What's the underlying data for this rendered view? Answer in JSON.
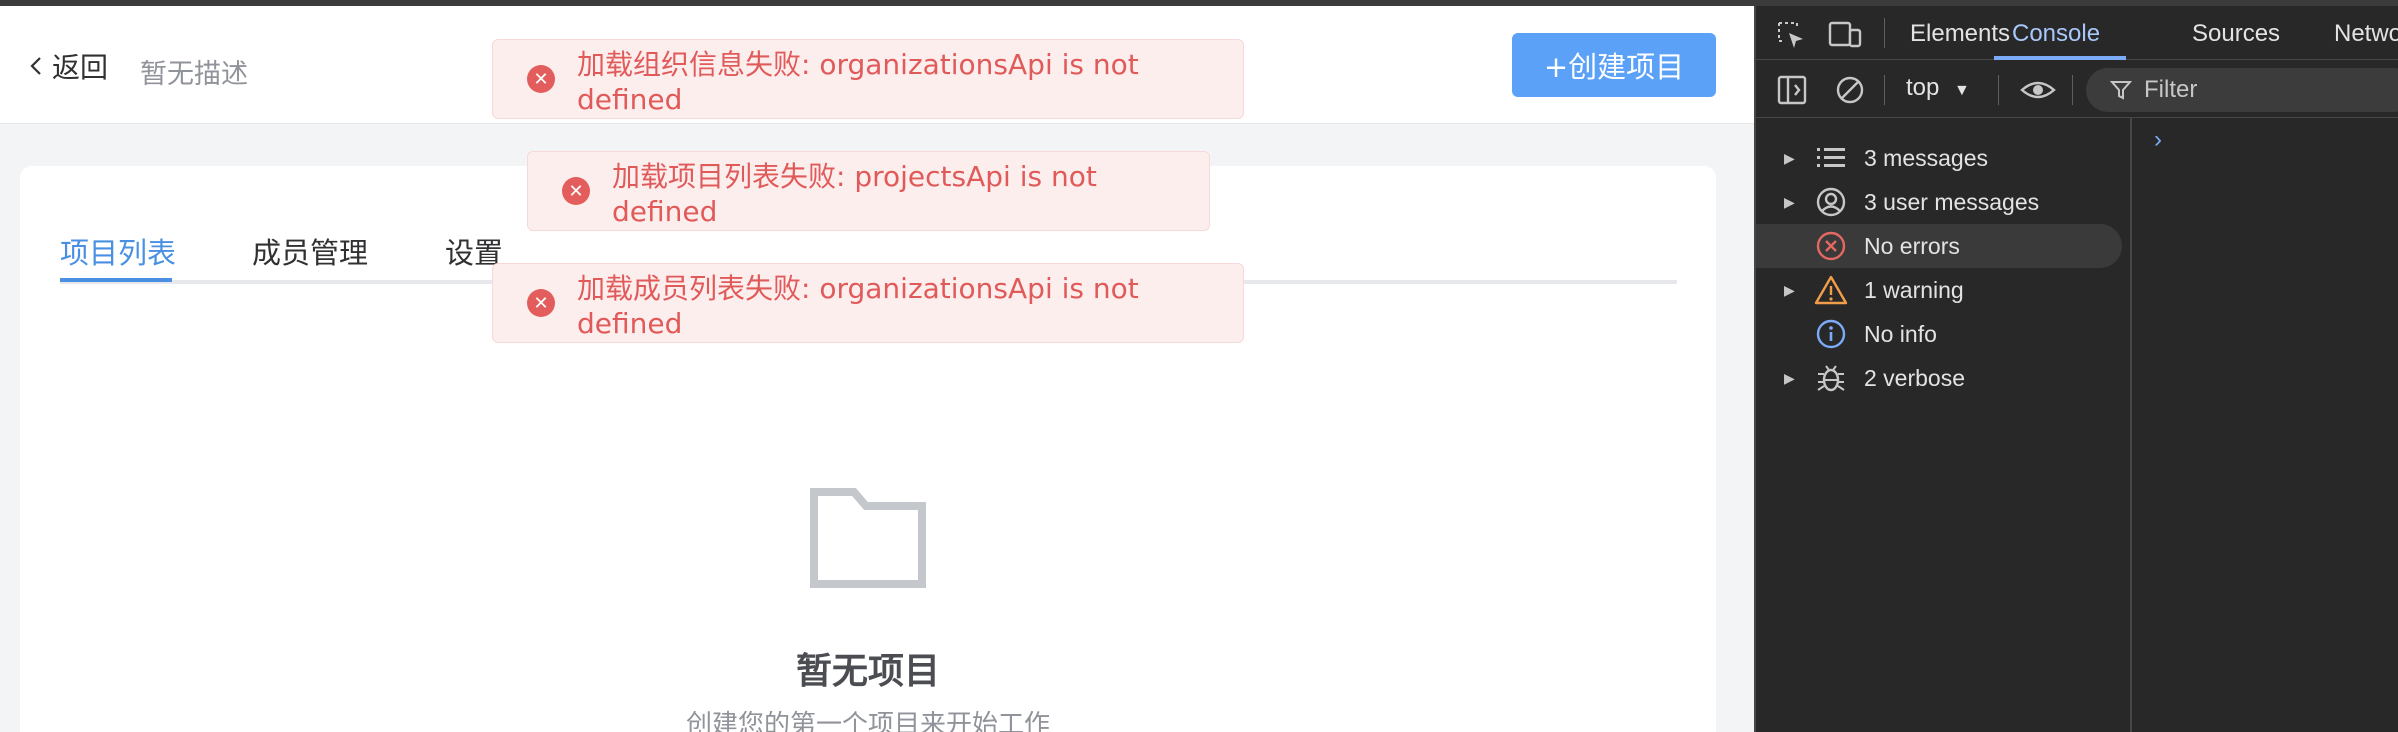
{
  "app": {
    "back_label": "返回",
    "description": "暂无描述",
    "create_button": "+创建项目",
    "tabs": [
      {
        "label": "项目列表",
        "active": true
      },
      {
        "label": "成员管理",
        "active": false
      },
      {
        "label": "设置",
        "active": false
      }
    ],
    "empty": {
      "title": "暂无项目",
      "subtitle": "创建您的第一个项目来开始工作"
    },
    "toasts": [
      {
        "text": "加载组织信息失败: organizationsApi is not defined"
      },
      {
        "text": "加载项目列表失败: projectsApi is not defined"
      },
      {
        "text": "加载成员列表失败: organizationsApi is not defined"
      }
    ],
    "colors": {
      "accent": "#4a90e2",
      "error": "#e35d5d",
      "button": "#5aa1f7"
    }
  },
  "devtools": {
    "tabs": [
      {
        "label": "Elements",
        "active": false
      },
      {
        "label": "Console",
        "active": true
      },
      {
        "label": "Sources",
        "active": false
      },
      {
        "label": "Network",
        "active": false
      }
    ],
    "context": "top",
    "filter_placeholder": "Filter",
    "sidebar": [
      {
        "label": "3 messages",
        "icon": "list-icon",
        "expandable": true
      },
      {
        "label": "3 user messages",
        "icon": "user-icon",
        "expandable": true
      },
      {
        "label": "No errors",
        "icon": "error-icon",
        "expandable": false,
        "selected": true
      },
      {
        "label": "1 warning",
        "icon": "warning-icon",
        "expandable": true
      },
      {
        "label": "No info",
        "icon": "info-icon",
        "expandable": false
      },
      {
        "label": "2 verbose",
        "icon": "bug-icon",
        "expandable": true
      }
    ],
    "prompt": "›"
  }
}
